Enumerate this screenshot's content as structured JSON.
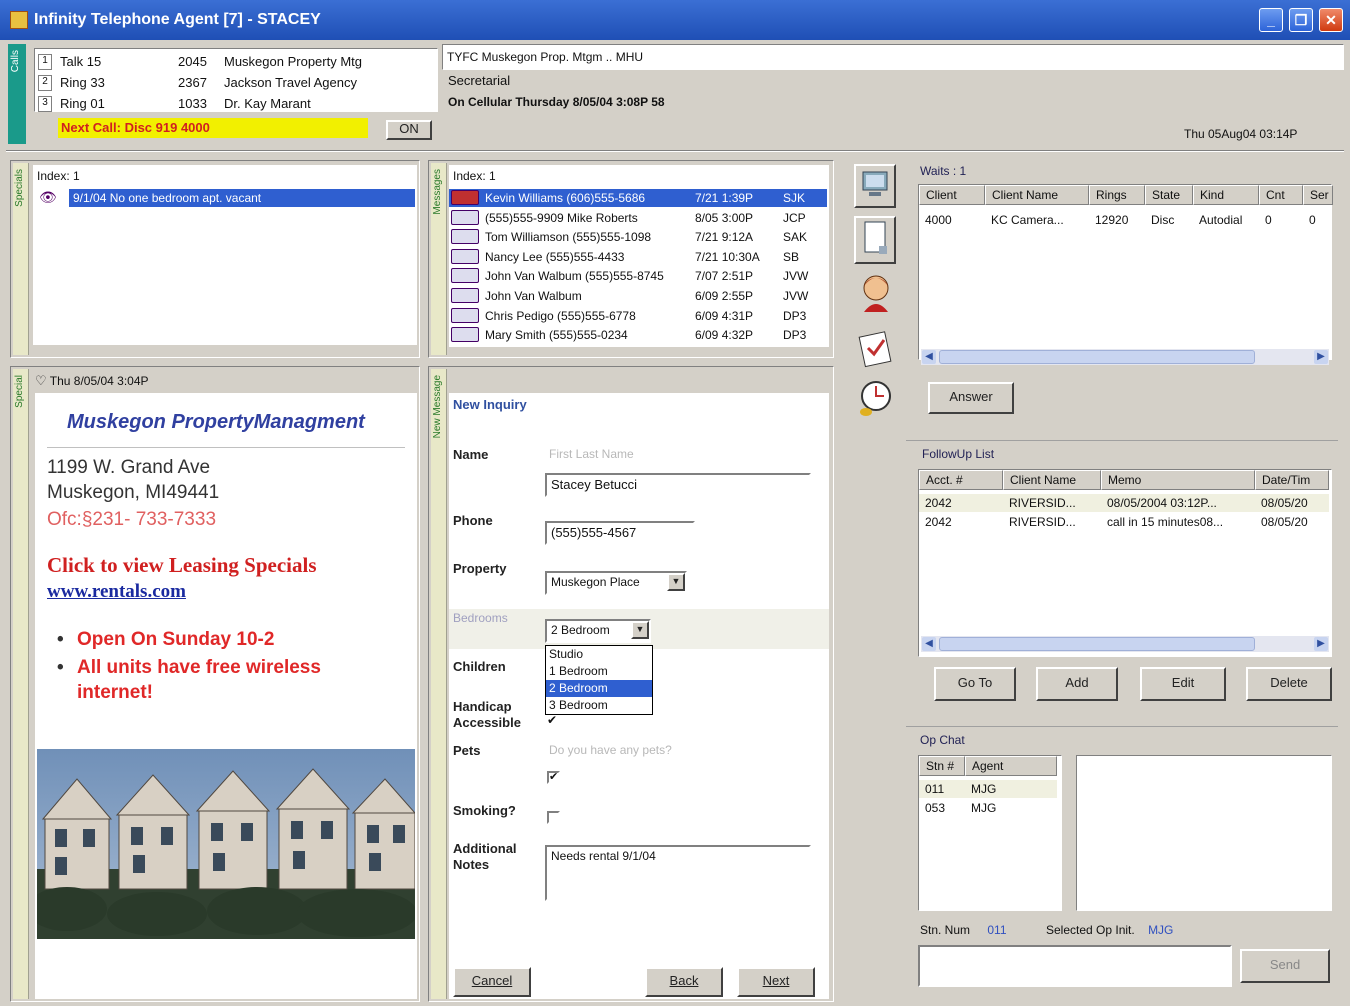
{
  "window": {
    "title": "Infinity Telephone Agent [7] - STACEY"
  },
  "calls": {
    "tab_label": "Calls",
    "lines": [
      {
        "num": "1",
        "status": "Talk 15",
        "code": "2045",
        "name": "Muskegon Property Mtg"
      },
      {
        "num": "2",
        "status": "Ring 33",
        "code": "2367",
        "name": "Jackson Travel Agency"
      },
      {
        "num": "3",
        "status": "Ring 01",
        "code": "1033",
        "name": "Dr. Kay Marant"
      }
    ],
    "next_call": "Next Call: Disc 919 4000",
    "on_button": "ON"
  },
  "call_info": {
    "client_line": "TYFC Muskegon Prop. Mtgm .. MHU",
    "role": "Secretarial",
    "status": "On Cellular Thursday 8/05/04 3:08P 58",
    "clock": "Thu 05Aug04 03:14P"
  },
  "specials_top": {
    "tab_label": "Specials",
    "header": "Index: 1",
    "item": "9/1/04  No one bedroom apt. vacant"
  },
  "messages": {
    "tab_label": "Messages",
    "header": "Index: 1",
    "rows": [
      {
        "text": "Kevin Williams (606)555-5686",
        "date": "7/21 1:39P",
        "ag": "SJK"
      },
      {
        "text": "(555)555-9909 Mike Roberts",
        "date": "8/05 3:00P",
        "ag": "JCP"
      },
      {
        "text": "Tom Williamson (555)555-1098",
        "date": "7/21 9:12A",
        "ag": "SAK"
      },
      {
        "text": "Nancy Lee  (555)555-4433",
        "date": "7/21 10:30A",
        "ag": "SB"
      },
      {
        "text": "John Van Walbum (555)555-8745",
        "date": "7/07 2:51P",
        "ag": "JVW"
      },
      {
        "text": "John   Van Walbum",
        "date": "6/09 2:55P",
        "ag": "JVW"
      },
      {
        "text": "Chris Pedigo (555)555-6778",
        "date": "6/09 4:31P",
        "ag": "DP3"
      },
      {
        "text": "Mary Smith (555)555-0234",
        "date": "6/09 4:32P",
        "ag": "DP3"
      }
    ]
  },
  "special_info": {
    "tab_label": "Special",
    "header": "Thu 8/05/04 3:04P",
    "company": "Muskegon PropertyManagment",
    "address1": "1199 W. Grand Ave",
    "address2": "Muskegon, MI49441",
    "phone": "Ofc:§231- 733-7333",
    "click": "Click  to view Leasing Specials",
    "url": "www.rentals.com",
    "bullets": [
      "Open On Sunday 10-2",
      "All units have free wireless internet!"
    ]
  },
  "inquiry": {
    "tab_label": "New Message",
    "title": "New Inquiry",
    "name_label": "Name",
    "name_placeholder": "First Last Name",
    "name_value": "Stacey Betucci",
    "phone_label": "Phone",
    "phone_value": "(555)555-4567",
    "property_label": "Property",
    "property_value": "Muskegon Place",
    "bedrooms_label": "Bedrooms",
    "bedrooms_value": "2 Bedroom",
    "bedroom_options": [
      "Studio",
      "1 Bedroom",
      "2 Bedroom",
      "3 Bedroom"
    ],
    "children_label": "Children",
    "handicap_label": "Handicap Accessible",
    "pets_label": "Pets",
    "pets_placeholder": "Do you have any pets?",
    "smoking_label": "Smoking?",
    "notes_label": "Additional Notes",
    "notes_value": "Needs rental 9/1/04",
    "cancel": "Cancel",
    "back": "Back",
    "next": "Next"
  },
  "waits": {
    "label": "Waits : 1",
    "columns": [
      "Client",
      "Client Name",
      "Rings",
      "State",
      "Kind",
      "Cnt",
      "Ser"
    ],
    "rows": [
      [
        "4000",
        "KC Camera...",
        "12920",
        "Disc",
        "Autodial",
        "0",
        "0"
      ]
    ],
    "answer": "Answer"
  },
  "followup": {
    "label": "FollowUp List",
    "columns": [
      "Acct. #",
      "Client Name",
      "Memo",
      "Date/Tim"
    ],
    "rows": [
      [
        "2042",
        "RIVERSID...",
        "08/05/2004 03:12P...",
        "08/05/20"
      ],
      [
        "2042",
        "RIVERSID...",
        "call in 15 minutes08...",
        "08/05/20"
      ]
    ],
    "goto": "Go To",
    "add": "Add",
    "edit": "Edit",
    "delete": "Delete"
  },
  "opchat": {
    "label": "Op Chat",
    "columns": [
      "Stn #",
      "Agent"
    ],
    "rows": [
      [
        "011",
        "MJG"
      ],
      [
        "053",
        "MJG"
      ]
    ],
    "stn_label": "Stn. Num",
    "stn_value": "011",
    "selected_label": "Selected Op Init.",
    "selected_value": "MJG",
    "send": "Send"
  },
  "colors": {
    "title_blue": "#1f4fb5",
    "highlight": "#2f5fd0",
    "next_call_bg": "#f2f000",
    "red_text": "#d02020",
    "company_blue": "#3040a0"
  }
}
